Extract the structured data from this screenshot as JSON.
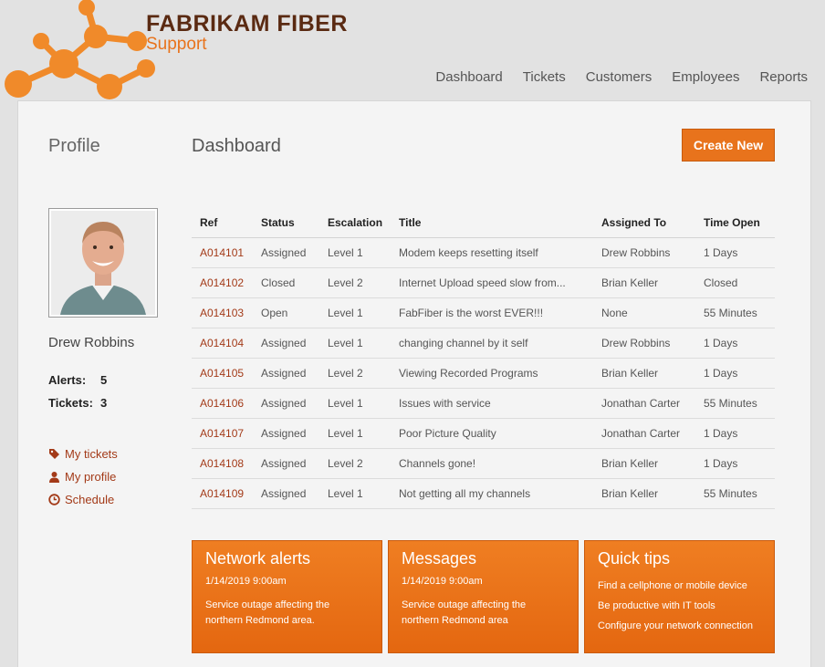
{
  "brand": {
    "title": "FABRIKAM FIBER",
    "subtitle": "Support"
  },
  "nav": [
    "Dashboard",
    "Tickets",
    "Customers",
    "Employees",
    "Reports"
  ],
  "sidebar": {
    "heading": "Profile",
    "user_name": "Drew Robbins",
    "alerts_label": "Alerts:",
    "alerts_value": "5",
    "tickets_label": "Tickets:",
    "tickets_value": "3",
    "links": [
      {
        "label": "My tickets",
        "icon": "tag-icon"
      },
      {
        "label": "My profile",
        "icon": "user-icon"
      },
      {
        "label": "Schedule",
        "icon": "clock-icon"
      }
    ]
  },
  "main": {
    "heading": "Dashboard",
    "create_label": "Create New",
    "table": {
      "headers": [
        "Ref",
        "Status",
        "Escalation",
        "Title",
        "Assigned To",
        "Time Open"
      ],
      "rows": [
        [
          "A014101",
          "Assigned",
          "Level 1",
          "Modem keeps resetting itself",
          "Drew Robbins",
          "1 Days"
        ],
        [
          "A014102",
          "Closed",
          "Level 2",
          "Internet Upload speed slow from...",
          "Brian Keller",
          "Closed"
        ],
        [
          "A014103",
          "Open",
          "Level 1",
          "FabFiber is the worst EVER!!!",
          "None",
          "55 Minutes"
        ],
        [
          "A014104",
          "Assigned",
          "Level 1",
          "changing channel by it self",
          "Drew Robbins",
          "1 Days"
        ],
        [
          "A014105",
          "Assigned",
          "Level 2",
          "Viewing Recorded Programs",
          "Brian Keller",
          "1 Days"
        ],
        [
          "A014106",
          "Assigned",
          "Level 1",
          "Issues with service",
          "Jonathan Carter",
          "55 Minutes"
        ],
        [
          "A014107",
          "Assigned",
          "Level 1",
          "Poor Picture Quality",
          "Jonathan Carter",
          "1 Days"
        ],
        [
          "A014108",
          "Assigned",
          "Level 2",
          "Channels gone!",
          "Brian Keller",
          "1 Days"
        ],
        [
          "A014109",
          "Assigned",
          "Level 1",
          "Not getting all my channels",
          "Brian Keller",
          "55 Minutes"
        ]
      ]
    },
    "cards": {
      "network": {
        "title": "Network alerts",
        "date": "1/14/2019 9:00am",
        "text": "Service outage affecting the northern Redmond area."
      },
      "messages": {
        "title": "Messages",
        "date": "1/14/2019 9:00am",
        "text": "Service outage affecting the northern Redmond area"
      },
      "tips": {
        "title": "Quick tips",
        "items": [
          "Find a cellphone or mobile device",
          "Be productive with IT tools",
          "Configure your network connection"
        ]
      }
    }
  },
  "colors": {
    "accent": "#e8731c",
    "link": "#a33a18",
    "brand_dark": "#5a2a12"
  }
}
